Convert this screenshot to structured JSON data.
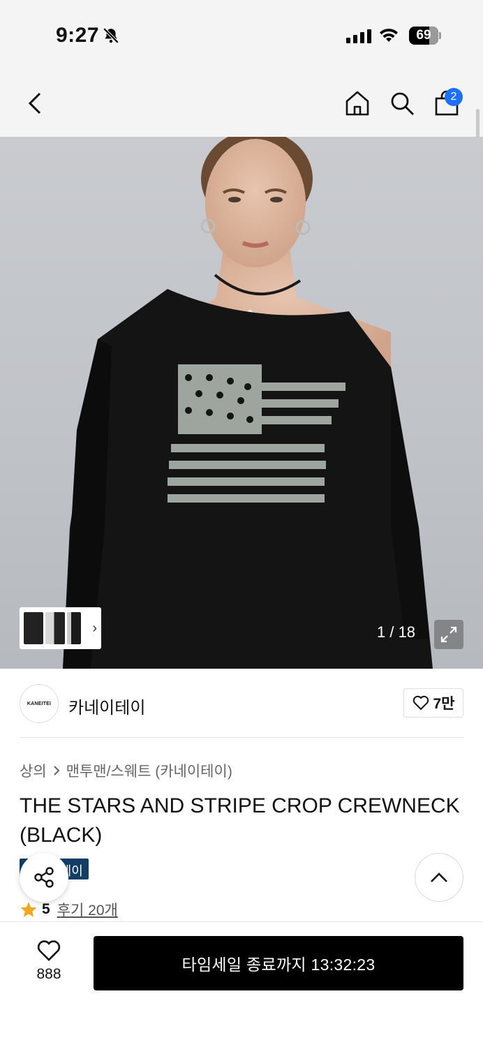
{
  "status_bar": {
    "time": "9:27",
    "battery": "69"
  },
  "header": {
    "cart_count": "2"
  },
  "gallery": {
    "counter": "1 / 18"
  },
  "brand": {
    "logo_text": "KANEITEI",
    "name": "카네이테이",
    "likes": "7만"
  },
  "breadcrumb": {
    "level1": "상의",
    "level2": "맨투맨/스웨트 (카네이테이)"
  },
  "product": {
    "title": "THE STARS AND STRIPE CROP CREWNECK (BLACK)",
    "tag": "카네이테이",
    "rating": "5",
    "reviews": "후기 20개"
  },
  "bottom": {
    "wish_count": "888",
    "buy_label": "타임세일 종료까지 13:32:23"
  },
  "colors": {
    "accent_blue": "#1e6fff",
    "tag_bg": "#123e66",
    "star": "#f5a623"
  }
}
